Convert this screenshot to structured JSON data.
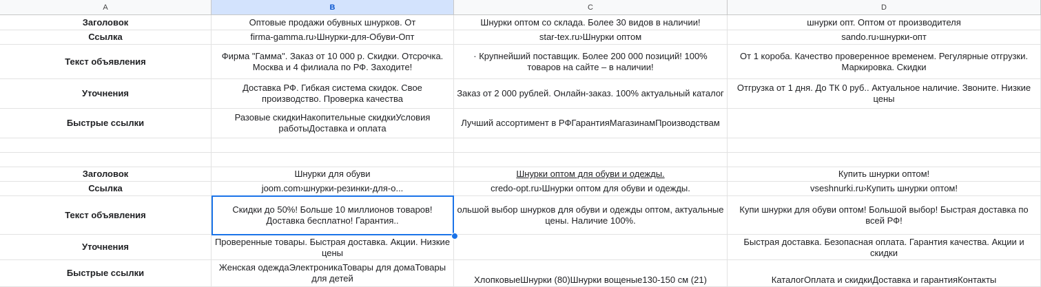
{
  "columns": [
    "A",
    "B",
    "C",
    "D"
  ],
  "groups": [
    {
      "rows": [
        {
          "label": "Заголовок",
          "cells": [
            "Оптовые продажи обувных шнурков. От",
            "Шнурки оптом со склада. Более 30 видов в наличии!",
            "шнурки опт. Оптом от производителя"
          ]
        },
        {
          "label": "Ссылка",
          "cells": [
            "firma-gamma.ru›Шнурки-для-Обуви-Опт",
            "star-tex.ru›Шнурки оптом",
            "sando.ru›шнурки-опт"
          ]
        },
        {
          "label": "Текст объявления",
          "cells": [
            "Фирма \"Гамма\". Заказ от 10 000 р. Скидки. Отсрочка. Москва и 4 филиала по РФ. Заходите!",
            "· Крупнейший поставщик. Более 200 000 позиций! 100% товаров на сайте – в наличии!",
            "От 1 короба. Качество проверенное временем. Регулярные отгрузки. Маркировка. Скидки"
          ]
        },
        {
          "label": "Уточнения",
          "cells": [
            "Доставка РФ. Гибкая система скидок. Свое производство. Проверка качества",
            "Заказ от 2 000 рублей. Онлайн-заказ. 100% актуальный каталог",
            "Отгрузка от 1 дня. До ТК 0 руб.. Актуальное наличие. Звоните. Низкие цены"
          ]
        },
        {
          "label": "Быстрые ссылки",
          "cells": [
            "Разовые скидкиНакопительные скидкиУсловия работыДоставка и оплата",
            "Лучший ассортимент в РФГарантияМагазинамПроизводствам",
            ""
          ]
        }
      ]
    },
    {
      "rows": [
        {
          "label": "Заголовок",
          "cells": [
            "Шнурки для обуви",
            "Шнурки оптом для обуви и одежды.",
            "Купить шнурки оптом!"
          ]
        },
        {
          "label": "Ссылка",
          "cells": [
            "joom.com›шнурки-резинки-для-о...",
            "credo-opt.ru›Шнурки оптом для обуви и одежды.",
            "vseshnurki.ru›Купить шнурки оптом!"
          ]
        },
        {
          "label": "Текст объявления",
          "cells": [
            "Скидки до 50%! Больше 10 миллионов товаров! Доставка бесплатно! Гарантия..",
            "ольшой выбор шнурков для обуви и одежды оптом, актуальные цены. Наличие 100%.",
            "Купи шнурки для обуви оптом! Большой выбор! Быстрая доставка по всей РФ!"
          ]
        },
        {
          "label": "Уточнения",
          "cells": [
            "Проверенные товары. Быстрая доставка. Акции. Низкие цены",
            "",
            "Быстрая доставка. Безопасная оплата. Гарантия качества. Акции и скидки"
          ]
        },
        {
          "label": "Быстрые ссылки",
          "cells": [
            "Женская одеждаЭлектроникаТовары для домаТовары для детей",
            "ХлопковыеШнурки (80)Шнурки вощеные130-150 см (21)",
            "КаталогОплата и скидкиДоставка и гарантияКонтакты"
          ]
        }
      ]
    }
  ]
}
